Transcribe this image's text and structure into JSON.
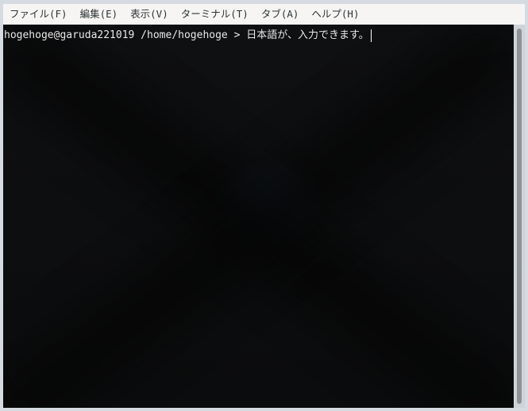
{
  "menubar": {
    "items": [
      {
        "label": "ファイル(F)"
      },
      {
        "label": "編集(E)"
      },
      {
        "label": "表示(V)"
      },
      {
        "label": "ターミナル(T)"
      },
      {
        "label": "タブ(A)"
      },
      {
        "label": "ヘルプ(H)"
      }
    ]
  },
  "terminal": {
    "prompt": "hogehoge@garuda221019 /home/hogehoge > ",
    "input": "日本語が、入力できます。"
  },
  "colors": {
    "menubar_bg": "#f6f5f4",
    "terminal_bg": "#0f1012",
    "terminal_text": "#e8e8e8"
  }
}
